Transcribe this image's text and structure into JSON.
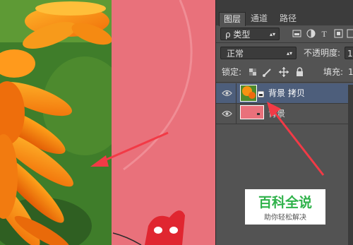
{
  "layers_panel": {
    "tabs": [
      {
        "label": "图层",
        "active": true
      },
      {
        "label": "通道",
        "active": false
      },
      {
        "label": "路径",
        "active": false
      }
    ],
    "filter": {
      "kind_label": "ρ 类型"
    },
    "blend_mode": {
      "value": "正常"
    },
    "opacity": {
      "label": "不透明度:",
      "value": "1"
    },
    "lock": {
      "label": "锁定:"
    },
    "fill": {
      "label": "填充:",
      "value": "1"
    },
    "layers": [
      {
        "name": "背景 拷贝",
        "selected": true,
        "visible": true
      },
      {
        "name": "背景",
        "selected": false,
        "visible": true
      }
    ]
  },
  "watermark": {
    "title": "百科全说",
    "subtitle": "助你轻松解决"
  },
  "colors": {
    "panel_bg": "#535353",
    "selected_layer": "#4d5e7b",
    "pink_canvas": "#e9717b",
    "arrow": "#f23a46",
    "watermark_title": "#2fb24a"
  }
}
